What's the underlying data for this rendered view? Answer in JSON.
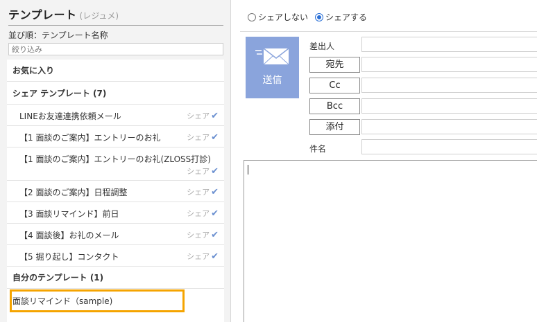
{
  "sidebar": {
    "title": "テンプレート",
    "subtitle": "(レジュメ)",
    "sort_label": "並び順：テンプレート名称",
    "filter_placeholder": "絞り込み",
    "favorites_label": "お気に入り",
    "shared_section_label": "シェア テンプレート (7)",
    "shared_items": [
      {
        "label": "LINEお友達連携依頼メール",
        "share": "シェア"
      },
      {
        "label": "【1 面談のご案内】エントリーのお礼",
        "share": "シェア"
      },
      {
        "label": "【1 面談のご案内】エントリーのお礼(ZLOSS打診)",
        "share": "シェア"
      },
      {
        "label": "【2 面談のご案内】日程調整",
        "share": "シェア"
      },
      {
        "label": "【3 面談リマインド】前日",
        "share": "シェア"
      },
      {
        "label": "【4 面談後】お礼のメール",
        "share": "シェア"
      },
      {
        "label": "【5 掘り起し】コンタクト",
        "share": "シェア"
      }
    ],
    "own_section_label": "自分のテンプレート (1)",
    "own_items": [
      {
        "label": "面談リマインド（sample)"
      }
    ]
  },
  "share_options": {
    "no_share_label": "シェアしない",
    "share_label": "シェアする",
    "selected": "share"
  },
  "compose": {
    "send_label": "送信",
    "sender_label": "差出人",
    "to_button": "宛先",
    "cc_button": "Cc",
    "bcc_button": "Bcc",
    "attach_button": "添付",
    "subject_label": "件名"
  },
  "colors": {
    "send_button": "#8aa4dc",
    "highlight_border": "#f5a400",
    "check": "#6a8fd0"
  }
}
